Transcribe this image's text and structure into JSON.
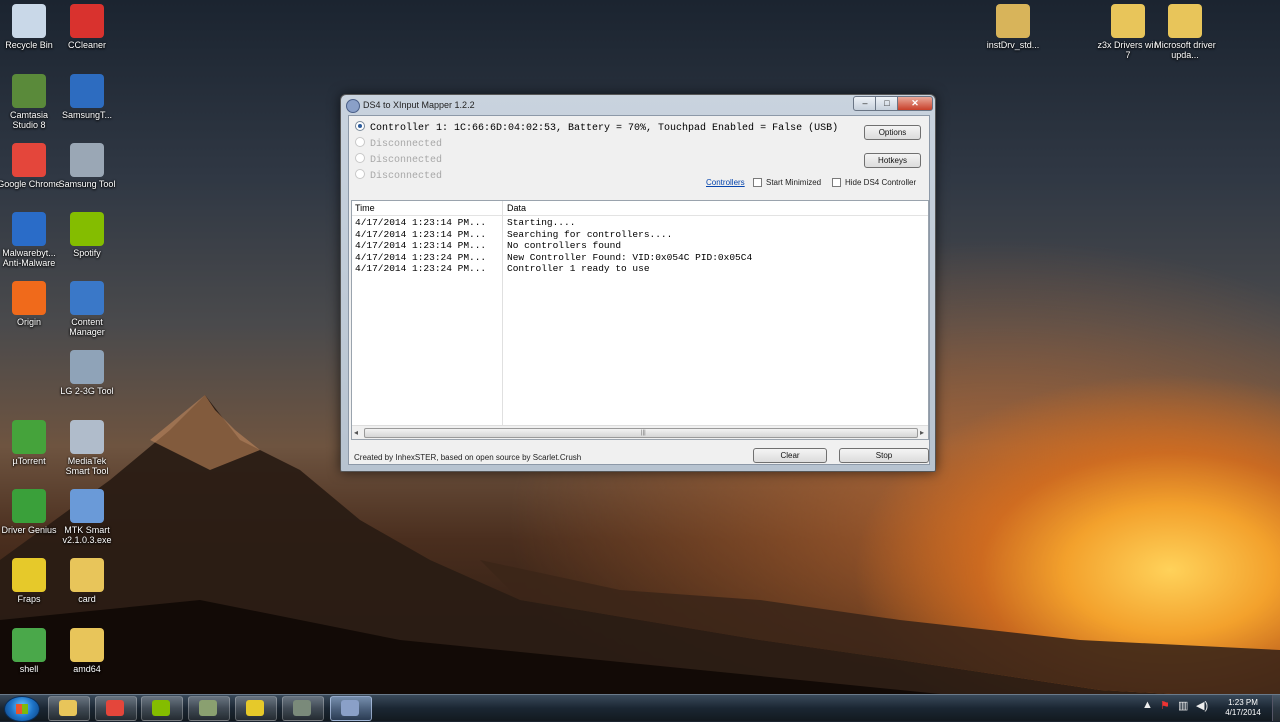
{
  "desktop": {
    "icons_left": [
      {
        "label": "Recycle Bin",
        "icon": "recycle-bin-icon",
        "color": "#c9d8e8"
      },
      {
        "label": "CCleaner",
        "icon": "ccleaner-icon",
        "color": "#d9322e"
      },
      {
        "label": "Camtasia Studio 8",
        "icon": "camtasia-icon",
        "color": "#5a8a3a"
      },
      {
        "label": "SamsungT...",
        "icon": "samsung-tool-icon",
        "color": "#2d6cc0"
      },
      {
        "label": "Google Chrome",
        "icon": "chrome-icon",
        "color": "#e4463b"
      },
      {
        "label": "Samsung Tool",
        "icon": "gear-icon",
        "color": "#9aa7b5"
      },
      {
        "label": "Malwarebyt... Anti-Malware",
        "icon": "malwarebytes-icon",
        "color": "#2a6cc8"
      },
      {
        "label": "Spotify",
        "icon": "spotify-icon",
        "color": "#84bd00"
      },
      {
        "label": "Origin",
        "icon": "origin-icon",
        "color": "#f06a1b"
      },
      {
        "label": "Content Manager",
        "icon": "content-manager-icon",
        "color": "#3a78c8"
      },
      {
        "label": "LG 2-3G Tool",
        "icon": "lg-tool-icon",
        "color": "#8fa3b8"
      },
      {
        "label": "µTorrent",
        "icon": "utorrent-icon",
        "color": "#45a33b"
      },
      {
        "label": "MediaTek Smart Tool",
        "icon": "mediatek-icon",
        "color": "#b0bccb"
      },
      {
        "label": "Driver Genius",
        "icon": "driver-genius-icon",
        "color": "#3aa03a"
      },
      {
        "label": "MTK Smart v2.1.0.3.exe",
        "icon": "exe-icon",
        "color": "#6a9ad8"
      },
      {
        "label": "Fraps",
        "icon": "fraps-icon",
        "color": "#e6c92a"
      },
      {
        "label": "card",
        "icon": "folder-icon",
        "color": "#e8c55a"
      },
      {
        "label": "shell",
        "icon": "shell-icon",
        "color": "#4aa84a"
      },
      {
        "label": "amd64",
        "icon": "folder-icon",
        "color": "#e8c55a"
      }
    ],
    "icons_right": [
      {
        "label": "instDrv_std...",
        "icon": "installer-icon",
        "color": "#d8b45a"
      },
      {
        "label": "z3x Drivers win 7",
        "icon": "folder-icon",
        "color": "#e8c55a"
      },
      {
        "label": "Microsoft driver upda...",
        "icon": "folder-icon",
        "color": "#e8c55a"
      }
    ]
  },
  "window": {
    "title": "DS4 to XInput Mapper 1.2.2",
    "min": "–",
    "max": "□",
    "close": "✕",
    "controllers": [
      {
        "text": "Controller 1: 1C:66:6D:04:02:53, Battery = 70%, Touchpad Enabled = False (USB)",
        "selected": true
      },
      {
        "text": "Disconnected",
        "selected": false
      },
      {
        "text": "Disconnected",
        "selected": false
      },
      {
        "text": "Disconnected",
        "selected": false
      }
    ],
    "options_label": "Options",
    "hotkeys_label": "Hotkeys",
    "controllers_link": "Controllers",
    "start_minimized_label": "Start Minimized",
    "hide_ds4_label": "Hide DS4 Controller",
    "log": {
      "columns": {
        "time": "Time",
        "data": "Data"
      },
      "rows": [
        {
          "time": "4/17/2014 1:23:14 PM...",
          "data": "Starting...."
        },
        {
          "time": "4/17/2014 1:23:14 PM...",
          "data": "Searching for controllers...."
        },
        {
          "time": "4/17/2014 1:23:14 PM...",
          "data": "No controllers found"
        },
        {
          "time": "4/17/2014 1:23:24 PM...",
          "data": "New Controller Found: VID:0x054C PID:0x05C4"
        },
        {
          "time": "4/17/2014 1:23:24 PM...",
          "data": "Controller 1 ready to use"
        }
      ]
    },
    "status_text": "Created by InhexSTER, based on open source by Scarlet.Crush",
    "clear_label": "Clear",
    "stop_label": "Stop"
  },
  "taskbar": {
    "clock_time": "1:23 PM",
    "clock_date": "4/17/2014",
    "items": [
      {
        "icon": "explorer-icon",
        "color": "#e8c55a"
      },
      {
        "icon": "chrome-icon",
        "color": "#e4463b"
      },
      {
        "icon": "spotify-icon",
        "color": "#84bd00"
      },
      {
        "icon": "camtasia-icon",
        "color": "#8aa070"
      },
      {
        "icon": "fraps-icon",
        "color": "#e6c92a"
      },
      {
        "icon": "camtasia-recorder-icon",
        "color": "#7a8a7a"
      },
      {
        "icon": "ds4-mapper-icon",
        "color": "#8aa0c8"
      }
    ],
    "tray_up_arrow": "▲"
  }
}
